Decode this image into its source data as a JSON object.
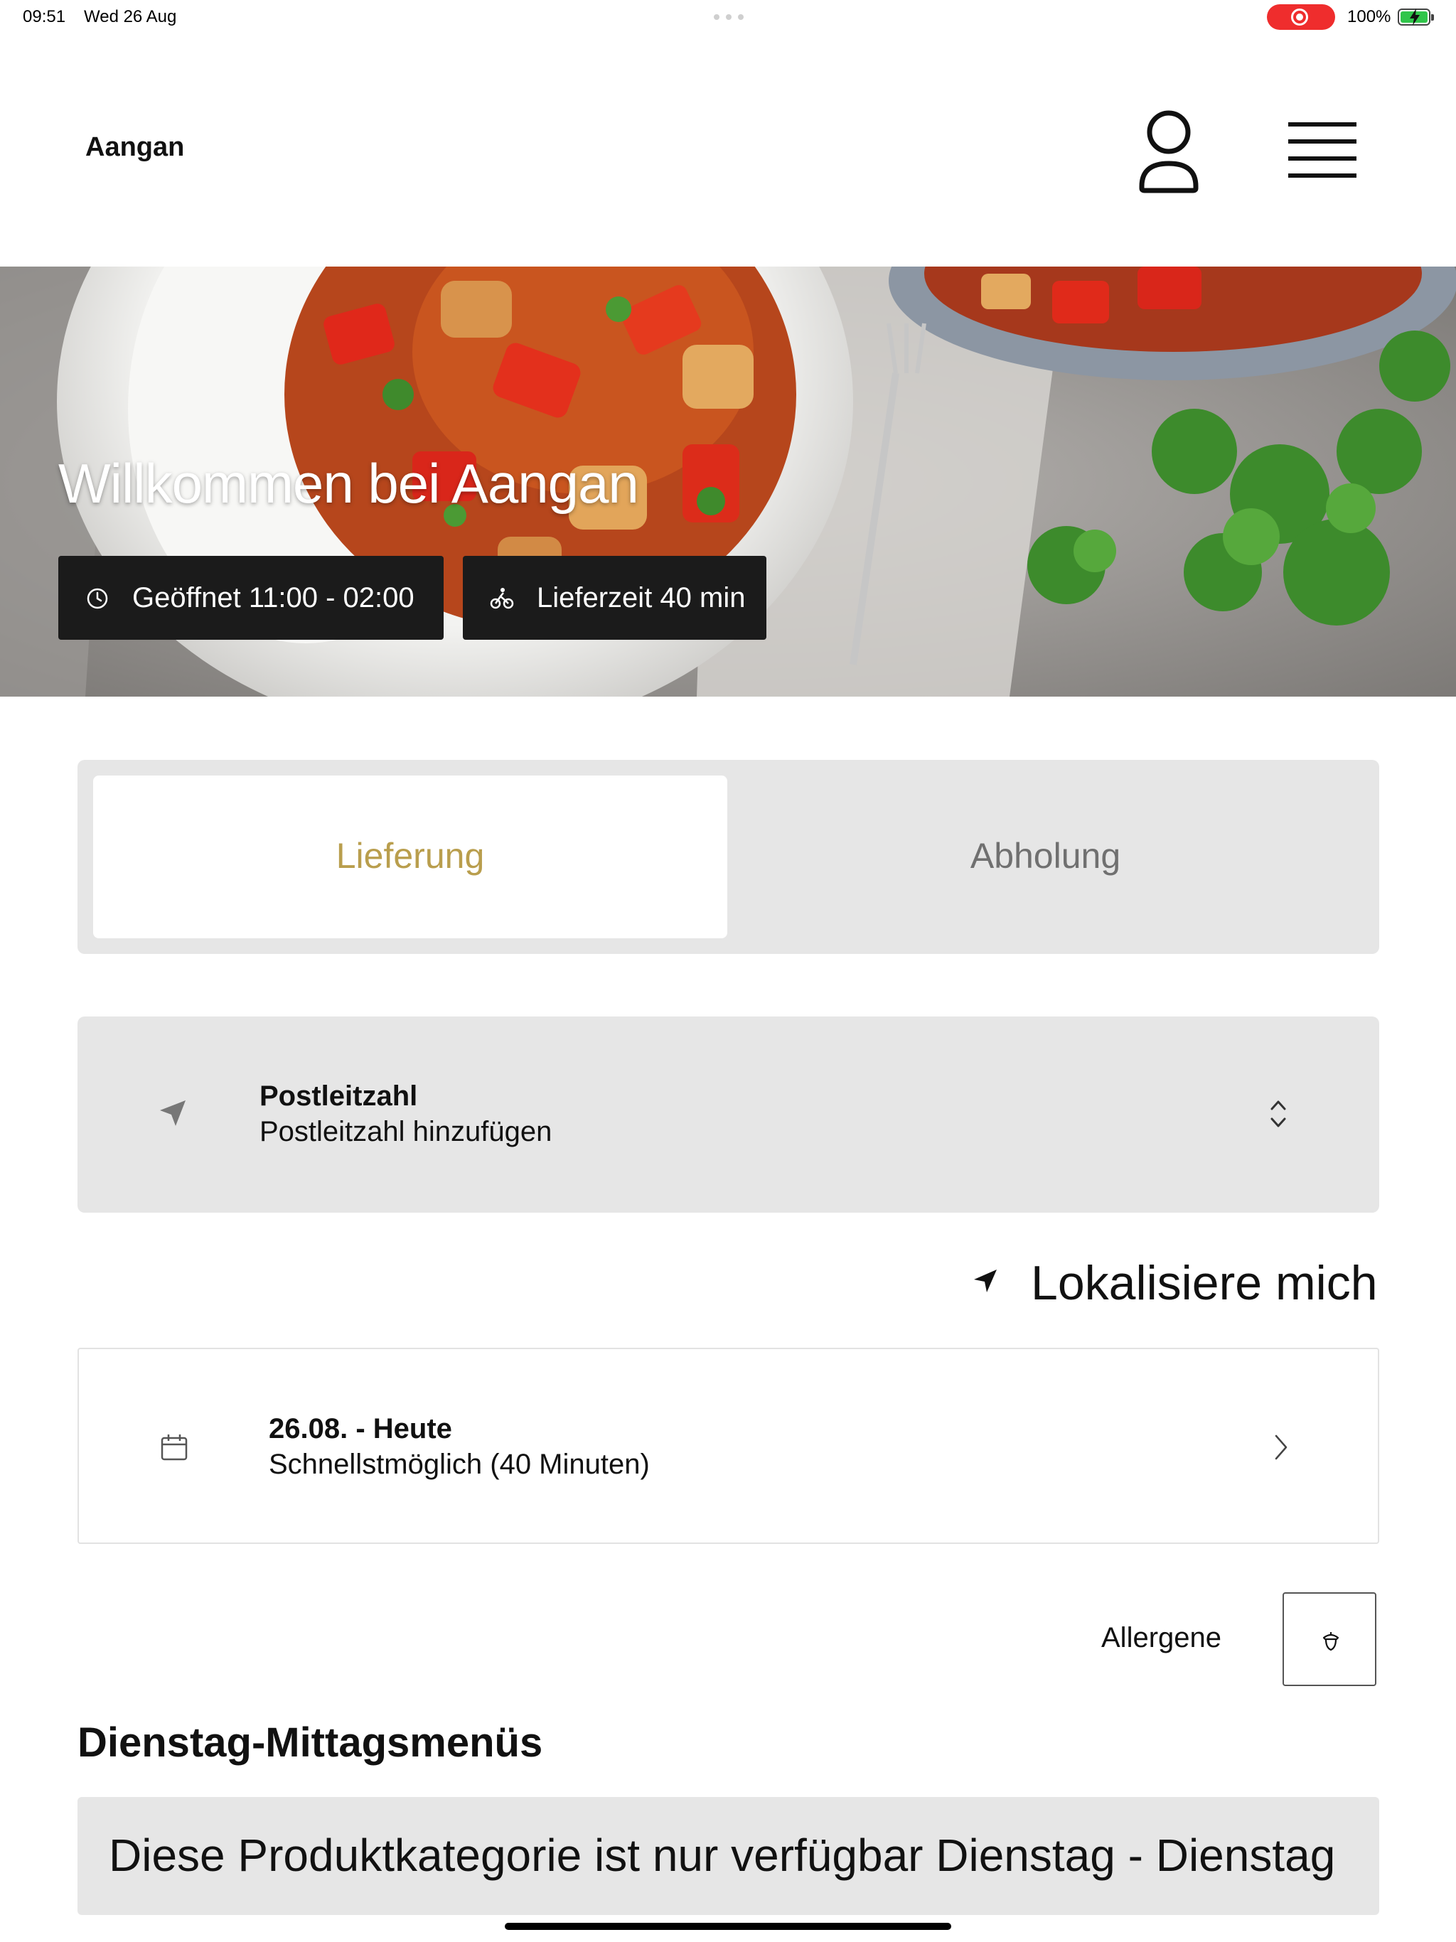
{
  "status_bar": {
    "time": "09:51",
    "date": "Wed 26 Aug",
    "battery": "100%",
    "record_color": "#ef2d2d",
    "battery_color": "#30c54a"
  },
  "header": {
    "brand": "Aangan",
    "user_icon": "user-icon",
    "menu_icon": "hamburger-menu-icon"
  },
  "hero": {
    "title": "Willkommen bei Aangan",
    "opening_hours": "Geöffnet 11:00 - 02:00",
    "delivery_time": "Lieferzeit 40 min",
    "opening_icon": "clock-icon",
    "delivery_icon": "bicycle-icon"
  },
  "tabs": {
    "delivery": "Lieferung",
    "pickup": "Abholung",
    "active": "delivery",
    "active_color": "#b99e4d"
  },
  "postcode": {
    "title": "Postleitzahl",
    "placeholder": "Postleitzahl hinzufügen",
    "icon": "location-arrow-icon"
  },
  "locate_me": {
    "label": "Lokalisiere mich",
    "icon": "navigation-arrow-icon"
  },
  "delivery_date": {
    "title": "26.08. - Heute",
    "subtitle": "Schnellstmöglich (40 Minuten)",
    "icon": "calendar-icon"
  },
  "allergens": {
    "label": "Allergene",
    "icon": "allergen-acorn-icon"
  },
  "category": {
    "title": "Dienstag-Mittagsmenüs",
    "availability": "Diese Produktkategorie ist nur verfügbar Dienstag - Dienstag"
  }
}
